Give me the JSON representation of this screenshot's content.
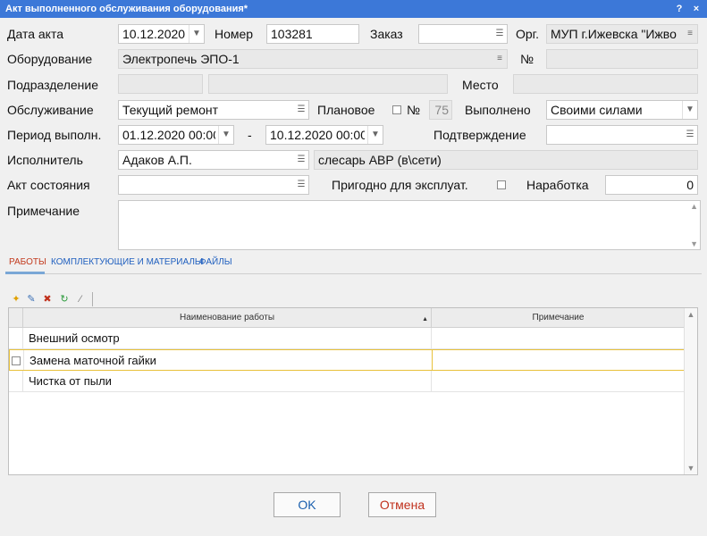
{
  "window": {
    "title": "Акт выполненного обслуживания оборудования*",
    "help_glyph": "?",
    "close_glyph": "×"
  },
  "form": {
    "date_label": "Дата акта",
    "date_value": "10.12.2020",
    "number_label": "Номер",
    "number_value": "103281",
    "order_label": "Заказ",
    "order_value": "",
    "org_label": "Орг.",
    "org_value": "МУП г.Ижевска \"Ижво",
    "equipment_label": "Оборудование",
    "equipment_value": "Электропечь ЭПО-1",
    "equip_num_label": "№",
    "equip_num_value": "",
    "division_label": "Подразделение",
    "division_code": "",
    "division_name": "",
    "place_label": "Место",
    "place_value": "",
    "service_label": "Обслуживание",
    "service_value": "Текущий ремонт",
    "planned_label": "Плановое",
    "planned_checked": false,
    "planned_num_label": "№",
    "planned_num_value": "75",
    "performed_label": "Выполнено",
    "performed_value": "Своими силами",
    "period_label": "Период выполн.",
    "period_from": "01.12.2020 00:00",
    "period_dash": "-",
    "period_to": "10.12.2020 00:00",
    "confirm_label": "Подтверждение",
    "confirm_value": "",
    "executor_label": "Исполнитель",
    "executor_value": "Адаков А.П.",
    "executor_role": "слесарь АВР (в\\сети)",
    "condition_label": "Акт состояния",
    "condition_value": "",
    "usable_label": "Пригодно для эксплуат.",
    "usable_checked": false,
    "runtime_label": "Наработка",
    "runtime_value": "0",
    "note_label": "Примечание",
    "note_value": ""
  },
  "tabs": [
    {
      "label": "РАБОТЫ",
      "active": true
    },
    {
      "label": "КОМПЛЕКТУЮЩИЕ И МАТЕРИАЛЫ",
      "active": false
    },
    {
      "label": "ФАЙЛЫ",
      "active": false
    }
  ],
  "toolbar_icons": [
    "add-icon",
    "edit-icon",
    "delete-icon",
    "refresh-icon",
    "wand-icon"
  ],
  "grid": {
    "columns": [
      "Наименование работы",
      "Примечание"
    ],
    "rows": [
      {
        "name": "Внешний осмотр",
        "note": ""
      },
      {
        "name": "Замена маточной гайки",
        "note": ""
      },
      {
        "name": "Чистка от пыли",
        "note": ""
      }
    ],
    "selected_row": 1
  },
  "buttons": {
    "ok": "OK",
    "cancel": "Отмена"
  },
  "colors": {
    "titlebar": "#3c78d8",
    "active_tab": "#c23a1e",
    "tab": "#1f5fbf",
    "ok_text": "#1a5fae",
    "cancel_text": "#c0301c",
    "selected_row_border": "#e8c13a"
  }
}
